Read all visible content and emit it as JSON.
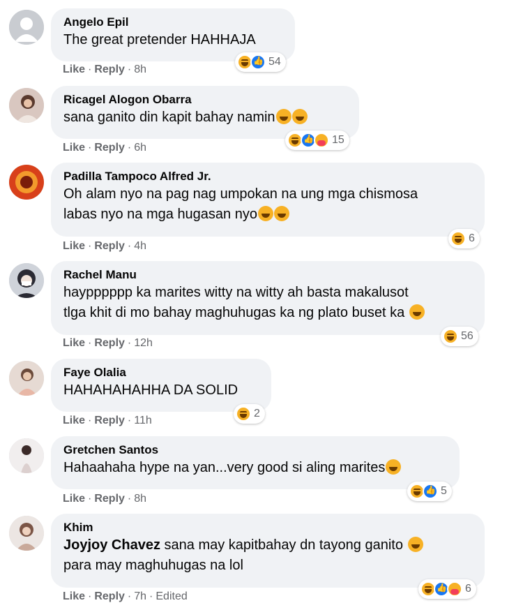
{
  "comments": [
    {
      "author": "Angelo Epil",
      "text": "The great pretender HAHHAJA",
      "like": "Like",
      "reply": "Reply",
      "time": "8h",
      "reactions": "54"
    },
    {
      "author": "Ricagel Alogon Obarra",
      "text": "sana ganito din kapit bahay namin",
      "like": "Like",
      "reply": "Reply",
      "time": "6h",
      "reactions": "15"
    },
    {
      "author": "Padilla Tampoco Alfred Jr.",
      "text_line1": "Oh alam nyo na pag nag umpokan na ung mga chismosa",
      "text_line2": "labas nyo na mga hugasan nyo",
      "like": "Like",
      "reply": "Reply",
      "time": "4h",
      "reactions": "6"
    },
    {
      "author": "Rachel Manu",
      "text_line1": "haypppppp ka marites witty na witty ah basta makalusot",
      "text_line2": "tlga khit di mo bahay maghuhugas ka ng plato buset ka",
      "like": "Like",
      "reply": "Reply",
      "time": "12h",
      "reactions": "56"
    },
    {
      "author": "Faye Olalia",
      "text": "HAHAHAHAHHA DA SOLID",
      "like": "Like",
      "reply": "Reply",
      "time": "11h",
      "reactions": "2"
    },
    {
      "author": "Gretchen Santos",
      "text": "Hahaahaha hype na yan...very good si aling marites",
      "like": "Like",
      "reply": "Reply",
      "time": "8h",
      "reactions": "5"
    },
    {
      "author": "Khim",
      "mention": "Joyjoy Chavez",
      "text_line1": "sana may kapitbahay dn tayong ganito",
      "text_line2": "para may maghuhugas na lol",
      "like": "Like",
      "reply": "Reply",
      "time": "7h",
      "edited": "Edited",
      "reactions": "6"
    }
  ],
  "colors": {
    "bubble": "#f0f2f5",
    "meta": "#65676b",
    "like_blue": "#1877f2",
    "haha_yellow": "#f7b125"
  }
}
